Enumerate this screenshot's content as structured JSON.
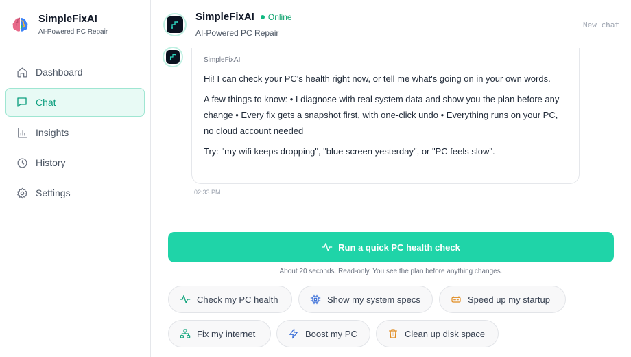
{
  "app": {
    "name": "SimpleFixAI",
    "tagline": "AI-Powered PC Repair"
  },
  "sidebar": {
    "items": [
      {
        "label": "Dashboard",
        "icon": "home-icon",
        "active": false
      },
      {
        "label": "Chat",
        "icon": "chat-icon",
        "active": true
      },
      {
        "label": "Insights",
        "icon": "bar-chart-icon",
        "active": false
      },
      {
        "label": "History",
        "icon": "clock-icon",
        "active": false
      },
      {
        "label": "Settings",
        "icon": "gear-icon",
        "active": false
      }
    ]
  },
  "header": {
    "title": "SimpleFixAI",
    "status": "Online",
    "subtitle": "AI-Powered PC Repair",
    "new_chat": "New chat"
  },
  "message": {
    "sender": "SimpleFixAI",
    "paragraphs": [
      "Hi! I can check your PC's health right now, or tell me what's going on in your own words.",
      "A few things to know: • I diagnose with real system data and show you the plan before any change • Every fix gets a snapshot first, with one-click undo • Everything runs on your PC, no cloud account needed",
      "Try: \"my wifi keeps dropping\", \"blue screen yesterday\", or \"PC feels slow\"."
    ],
    "time": "02:33 PM"
  },
  "actions": {
    "primary_label": "Run a quick PC health check",
    "primary_note": "About 20 seconds. Read-only. You see the plan before anything changes.",
    "chips": [
      {
        "label": "Check my PC health",
        "icon": "pulse-icon"
      },
      {
        "label": "Show my system specs",
        "icon": "cpu-icon"
      },
      {
        "label": "Speed up my startup",
        "icon": "gauge-icon"
      },
      {
        "label": "Fix my internet",
        "icon": "network-icon"
      },
      {
        "label": "Boost my PC",
        "icon": "lightning-icon"
      },
      {
        "label": "Clean up disk space",
        "icon": "trash-icon"
      }
    ]
  },
  "colors": {
    "accent": "#1fd4a8",
    "accent_text": "#0d9f7f",
    "online": "#10b981"
  }
}
